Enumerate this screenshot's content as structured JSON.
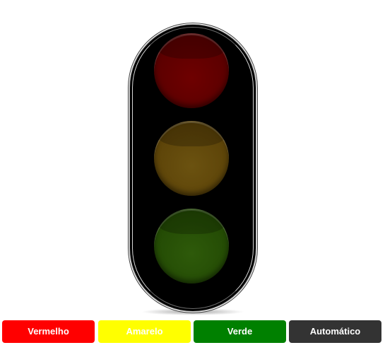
{
  "traffic_light": {
    "lamps": [
      {
        "name": "red",
        "color": "#5a0000",
        "active": false
      },
      {
        "name": "yellow",
        "color": "#5c4308",
        "active": false
      },
      {
        "name": "green",
        "color": "#234a04",
        "active": false
      }
    ]
  },
  "controls": {
    "buttons": [
      {
        "label": "Vermelho",
        "color": "#ff0000"
      },
      {
        "label": "Amarelo",
        "color": "#ffff00"
      },
      {
        "label": "Verde",
        "color": "#008000"
      },
      {
        "label": "Automático",
        "color": "#333333"
      }
    ]
  }
}
